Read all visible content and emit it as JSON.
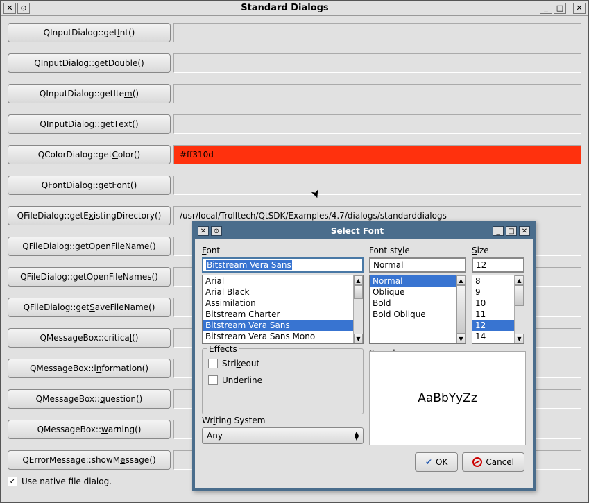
{
  "window": {
    "title": "Standard Dialogs"
  },
  "rows": [
    {
      "label_pre": "QInputDialog::get",
      "u": "I",
      "label_post": "nt()",
      "result": ""
    },
    {
      "label_pre": "QInputDialog::get",
      "u": "D",
      "label_post": "ouble()",
      "result": ""
    },
    {
      "label_pre": "QInputDialog::getIte",
      "u": "m",
      "label_post": "()",
      "result": ""
    },
    {
      "label_pre": "QInputDialog::get",
      "u": "T",
      "label_post": "ext()",
      "result": ""
    },
    {
      "label_pre": "QColorDialog::get",
      "u": "C",
      "label_post": "olor()",
      "result": "#ff310d",
      "color": true
    },
    {
      "label_pre": "QFontDialog::get",
      "u": "F",
      "label_post": "ont()",
      "result": ""
    },
    {
      "label_pre": "QFileDialog::getE",
      "u": "x",
      "label_post": "istingDirectory()",
      "result": "/usr/local/Trolltech/QtSDK/Examples/4.7/dialogs/standarddialogs"
    },
    {
      "label_pre": "QFileDialog::get",
      "u": "O",
      "label_post": "penFileName()",
      "result": ""
    },
    {
      "label_pre": "QFileDialog::",
      "u": "g",
      "label_post": "etOpenFileNames()",
      "result": ""
    },
    {
      "label_pre": "QFileDialog::get",
      "u": "S",
      "label_post": "aveFileName()",
      "result": ""
    },
    {
      "label_pre": "QMessageBox::critica",
      "u": "l",
      "label_post": "()",
      "result": ""
    },
    {
      "label_pre": "QMessageBox::i",
      "u": "n",
      "label_post": "formation()",
      "result": ""
    },
    {
      "label_pre": "QMessageBox::",
      "u": "q",
      "label_post": "uestion()",
      "result": ""
    },
    {
      "label_pre": "QMessageBox::",
      "u": "w",
      "label_post": "arning()",
      "result": ""
    },
    {
      "label_pre": "QErrorMessage::showM",
      "u": "e",
      "label_post": "ssage()",
      "result": ""
    }
  ],
  "native_checkbox": {
    "checked": true,
    "label": "Use native file dialog."
  },
  "font_dialog": {
    "title": "Select Font",
    "font": {
      "label": "Font",
      "value": "Bitstream Vera Sans",
      "list": [
        "Arial",
        "Arial Black",
        "Assimilation",
        "Bitstream Charter",
        "Bitstream Vera Sans",
        "Bitstream Vera Sans Mono"
      ],
      "selected_index": 4
    },
    "style": {
      "label": "Font style",
      "value": "Normal",
      "list": [
        "Normal",
        "Oblique",
        "Bold",
        "Bold Oblique"
      ],
      "selected_index": 0
    },
    "size": {
      "label": "Size",
      "value": "12",
      "list": [
        "8",
        "9",
        "10",
        "11",
        "12",
        "14"
      ],
      "selected_index": 4
    },
    "effects": {
      "label": "Effects",
      "strikeout": "Strikeout",
      "underline": "Underline",
      "strikeout_checked": false,
      "underline_checked": false
    },
    "sample": {
      "label": "Sample",
      "text": "AaBbYyZz"
    },
    "writing_system": {
      "label": "Writing System",
      "value": "Any"
    },
    "buttons": {
      "ok": "OK",
      "cancel": "Cancel"
    }
  }
}
